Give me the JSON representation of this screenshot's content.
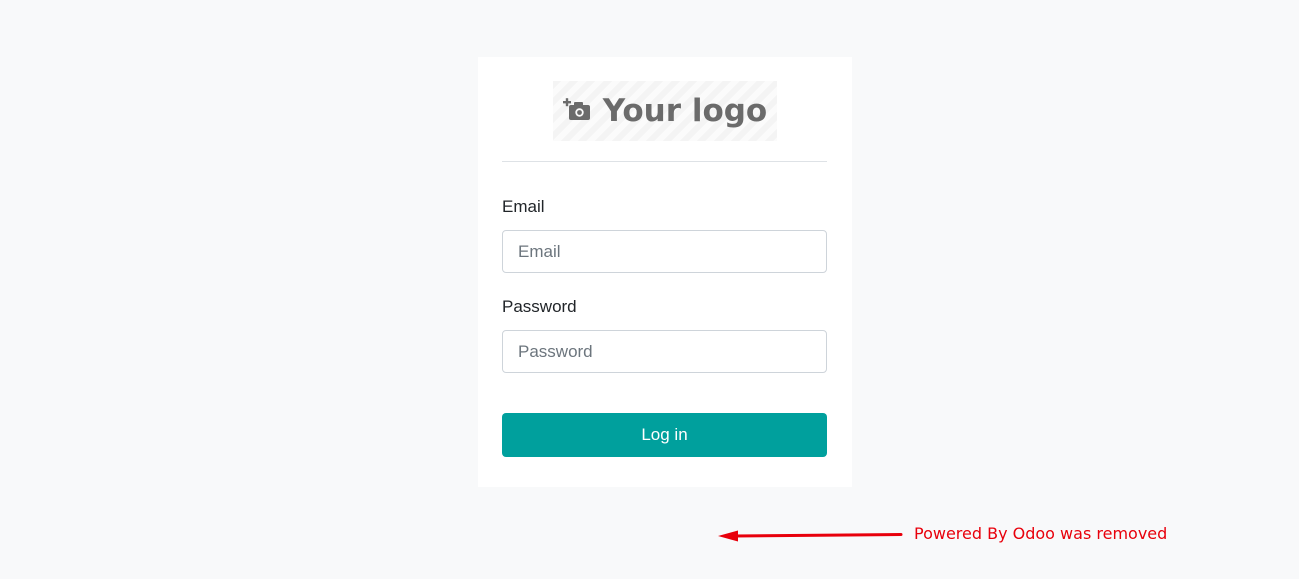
{
  "logo": {
    "text": "Your logo",
    "icon": "camera-plus-icon"
  },
  "form": {
    "email_label": "Email",
    "email_placeholder": "Email",
    "password_label": "Password",
    "password_placeholder": "Password",
    "login_label": "Log in"
  },
  "annotation": {
    "text": "Powered By Odoo was removed",
    "icon": "left-arrow-icon"
  },
  "colors": {
    "page_background": "#f8f9fa",
    "primary_button": "#00a09d",
    "annotation": "#e8000b"
  }
}
